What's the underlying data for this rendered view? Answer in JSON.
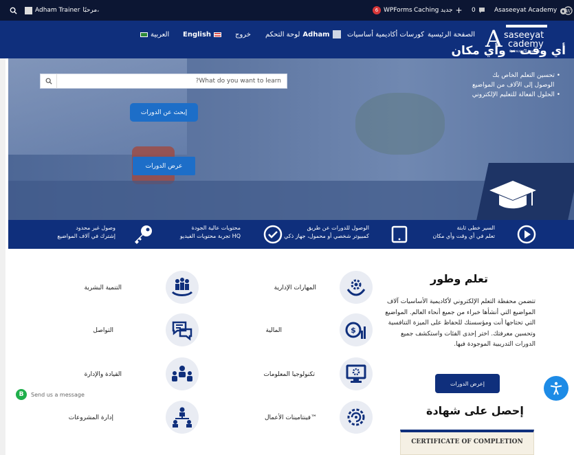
{
  "adminbar": {
    "greeting": "مرحبًا،",
    "user_name": "Adham Trainer",
    "site_name": "Asaseeyat Academy",
    "comments_count": "0",
    "new_label": "جديد",
    "caching_label": "Caching",
    "wpforms_label": "WPForms",
    "wpforms_badge": "6"
  },
  "nav": {
    "logo_text": "saseeyat\ncademy",
    "logo_line1": "saseeyat",
    "logo_line2": "cademy",
    "logo_tagline": "Optimizing e-Learning",
    "home": "الصفحة الرئيسية",
    "courses": "كورسات أكاديمية أساسيات",
    "user_name": "Adham",
    "dashboard": "لوحة التحكم",
    "logout": "خروج",
    "english": "English",
    "arabic": "العربية"
  },
  "hero": {
    "search_button": "إبحث عن الدورات",
    "search_placeholder": "What do you want to learn?",
    "view_courses_button": "عرض الدورات",
    "title": "أي وقت – وأي مكان",
    "bullets": [
      "تحسين التعلم الخاص بك",
      "الوصول إلى الآلاف من المواضيع",
      "الحلول الفعالة للتعليم الإلكتروني"
    ]
  },
  "features": [
    {
      "title": "السير خطى ثابتة",
      "sub": "تعلم في أي وقت وأي مكان",
      "icon": "play-circle-icon"
    },
    {
      "title": "الوصول للدورات عن طريق",
      "sub": "كمبيوتر شخصي أو محمول، جهاز ذكي",
      "icon": "tablet-icon"
    },
    {
      "title": "محتويات عالية الجودة",
      "sub": "تجربة محتويات الفيديو HQ",
      "icon": "check-circle-icon"
    },
    {
      "title": "وصول غير محدود",
      "sub": "إشترك في آلاف المواضيع",
      "icon": "key-icon"
    }
  ],
  "learn": {
    "title": "تعلم وطور",
    "description": "تتضمن محفظة التعلم الإلكتروني لأكاديمية الأساسيات آلاف المواضيع التي أنشأها خبراء من جميع أنحاء العالم. المواضيع التي تحتاجها أنت ومؤسستك للحفاظ على الميزة التنافسية وتحسين معرفتك. اختر إحدى الفئات واستكشف جميع الدورات التدريبية الموجودة فيها.",
    "button": "إعرض الدورات"
  },
  "categories": [
    {
      "label": "المهارات الإدارية",
      "icon": "gear-hands-icon"
    },
    {
      "label": "التنمية البشرية",
      "icon": "people-hand-icon"
    },
    {
      "label": "المالية",
      "icon": "finance-chart-icon"
    },
    {
      "label": "التواصل",
      "icon": "chat-bubbles-icon"
    },
    {
      "label": "تكنولوجيا المعلومات",
      "icon": "monitor-gear-icon"
    },
    {
      "label": "القيادة والإدارة",
      "icon": "team-leader-icon"
    },
    {
      "label": "فينتامينات الأعمال™",
      "icon": "brain-gear-icon"
    },
    {
      "label": "إدارة المشروعات",
      "icon": "org-chart-icon"
    }
  ],
  "certificate": {
    "title": "إحصل على شهادة",
    "card_text": "CERTIFICATE OF COMPLETION"
  },
  "chat": {
    "label": "Send us a message",
    "badge": "B"
  },
  "colors": {
    "navy": "#0f2f7c",
    "adminbar": "#0c1633",
    "accent": "#1d6ec8",
    "a11y": "#1d8be6"
  }
}
